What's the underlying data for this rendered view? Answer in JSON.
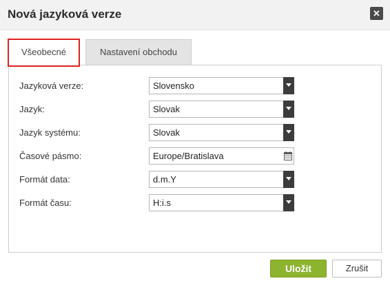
{
  "dialog": {
    "title": "Nová jazyková verze",
    "close_icon": "close-icon"
  },
  "tabs": [
    {
      "label": "Všeobecné",
      "active": true
    },
    {
      "label": "Nastavení obchodu",
      "active": false
    }
  ],
  "form": {
    "fields": [
      {
        "label": "Jazyková verze:",
        "value": "Slovensko",
        "kind": "select"
      },
      {
        "label": "Jazyk:",
        "value": "Slovak",
        "kind": "select"
      },
      {
        "label": "Jazyk systému:",
        "value": "Slovak",
        "kind": "select"
      },
      {
        "label": "Časové pásmo:",
        "value": "Europe/Bratislava",
        "kind": "date",
        "icon": "calendar-icon"
      },
      {
        "label": "Formát data:",
        "value": "d.m.Y",
        "kind": "select"
      },
      {
        "label": "Formát času:",
        "value": "H:i.s",
        "kind": "select"
      }
    ]
  },
  "footer": {
    "save_label": "Uložit",
    "cancel_label": "Zrušit"
  },
  "colors": {
    "save_button": "#8db42f",
    "tab_highlight": "#e02020",
    "select_arrow_bg": "#3c3c3c"
  }
}
